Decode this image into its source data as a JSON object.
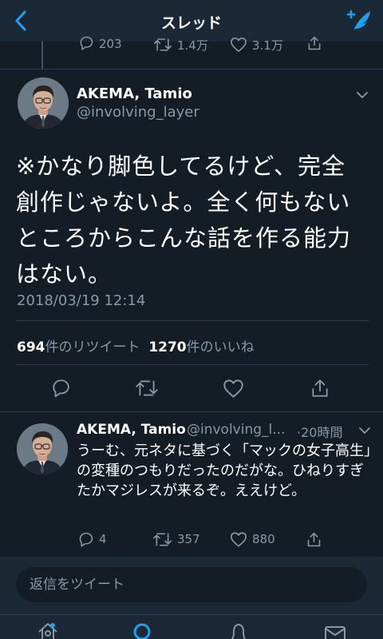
{
  "header": {
    "title": "スレッド"
  },
  "previous_tweet": {
    "replies": "203",
    "retweets": "1.4万",
    "likes": "3.1万"
  },
  "main_tweet": {
    "name": "AKEMA, Tamio",
    "handle": "@involving_layer",
    "text": "※かなり脚色してるけど、完全創作じゃないよ。全く何もないところからこんな話を作る能力はない。",
    "timestamp": "2018/03/19 12:14",
    "retweet_count": "694",
    "retweet_label": "件のリツイート",
    "like_count": "1270",
    "like_label": "件のいいね"
  },
  "reply_tweet": {
    "name": "AKEMA, Tamio",
    "handle": "@involving_l...",
    "time": "·20時間",
    "text": "うーむ、元ネタに基づく「マックの女子高生」の変種のつもりだったのだがな。ひねりすぎたかマジレスが来るぞ。ええけど。",
    "replies": "4",
    "retweets": "357",
    "likes": "880"
  },
  "reply_bar": {
    "placeholder": "返信をツイート"
  },
  "colors": {
    "background": "#141d26",
    "bar": "#1b2836",
    "accent": "#1da1f2",
    "secondary_text": "#8899a6"
  },
  "icons": [
    "back-arrow-icon",
    "compose-tweet-icon",
    "reply-icon",
    "retweet-icon",
    "like-icon",
    "share-icon",
    "chevron-down-icon",
    "home-icon",
    "search-icon",
    "notifications-icon",
    "messages-icon"
  ]
}
